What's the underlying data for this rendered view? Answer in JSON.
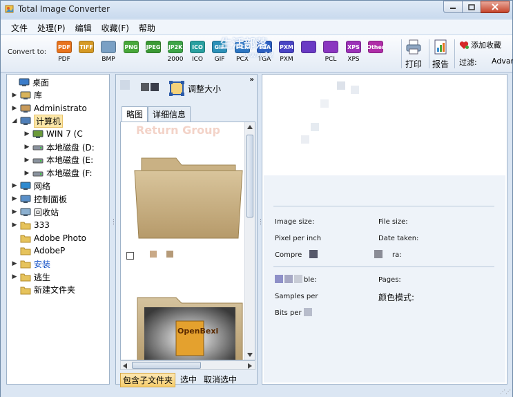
{
  "window": {
    "title": "Total Image Converter"
  },
  "menu": {
    "items": [
      "文件",
      "处理(P)",
      "编辑",
      "收藏(F)",
      "帮助"
    ]
  },
  "toolbar": {
    "convert_label": "Convert to:",
    "formats": [
      {
        "badge": "PDF",
        "label": "PDF",
        "color": "#e8731d"
      },
      {
        "badge": "TIFF",
        "label": "",
        "color": "#d69a25"
      },
      {
        "badge": "",
        "label": "BMP",
        "color": "#7aa0c4"
      },
      {
        "badge": "PNG",
        "label": "",
        "color": "#49a83a"
      },
      {
        "badge": "JPEG",
        "label": "",
        "color": "#3c9a35"
      },
      {
        "badge": "JP2K",
        "label": "2000",
        "color": "#3ea548"
      },
      {
        "badge": "ICO",
        "label": "ICO",
        "color": "#2aa0a0"
      },
      {
        "badge": "GIF",
        "label": "GIF",
        "color": "#2c91b8"
      },
      {
        "badge": "PCX",
        "label": "PCX",
        "color": "#2c76c2"
      },
      {
        "badge": "TGA",
        "label": "TGA",
        "color": "#2c5fc2"
      },
      {
        "badge": "PXM",
        "label": "PXM",
        "color": "#4a44c4"
      },
      {
        "badge": "",
        "label": "",
        "color": "#6a3ac4"
      },
      {
        "badge": "",
        "label": "PCL",
        "color": "#8a36c0"
      },
      {
        "badge": "XPS",
        "label": "XPS",
        "color": "#9c32b8"
      },
      {
        "badge": "Other",
        "label": "",
        "color": "#b02ea8"
      }
    ],
    "print_label": "打印",
    "report_label": "报告",
    "add_favorite": "添加收藏",
    "filter_label": "过滤:",
    "filter_value": "Advan"
  },
  "watermark": {
    "title": "生活部落  ",
    "url": "www.12"
  },
  "tree": {
    "items": [
      {
        "label": "桌面",
        "level": 0,
        "twisty": "",
        "icon": "desktop-icon"
      },
      {
        "label": "库",
        "level": 1,
        "twisty": "▶",
        "icon": "library-icon"
      },
      {
        "label": "Administrato",
        "level": 1,
        "twisty": "▶",
        "icon": "user-icon"
      },
      {
        "label": "计算机",
        "level": 1,
        "twisty": "◢",
        "icon": "computer-icon",
        "selected": true
      },
      {
        "label": "WIN 7 (C",
        "level": 2,
        "twisty": "▶",
        "icon": "windows-drive-icon"
      },
      {
        "label": "本地磁盘 (D:",
        "level": 2,
        "twisty": "▶",
        "icon": "drive-icon"
      },
      {
        "label": "本地磁盘 (E:",
        "level": 2,
        "twisty": "▶",
        "icon": "drive-icon"
      },
      {
        "label": "本地磁盘 (F:",
        "level": 2,
        "twisty": "▶",
        "icon": "drive-icon"
      },
      {
        "label": "网络",
        "level": 1,
        "twisty": "▶",
        "icon": "network-icon"
      },
      {
        "label": "控制面板",
        "level": 1,
        "twisty": "▶",
        "icon": "control-panel-icon"
      },
      {
        "label": "回收站",
        "level": 1,
        "twisty": "▶",
        "icon": "recycle-bin-icon"
      },
      {
        "label": "333",
        "level": 1,
        "twisty": "▶",
        "icon": "folder-icon"
      },
      {
        "label": "Adobe Photo",
        "level": 1,
        "twisty": "",
        "icon": "folder-icon"
      },
      {
        "label": "AdobeP",
        "level": 1,
        "twisty": "",
        "icon": "folder-icon"
      },
      {
        "label": "安装",
        "level": 1,
        "twisty": "▶",
        "icon": "folder-icon",
        "blue": true
      },
      {
        "label": "逃生",
        "level": 1,
        "twisty": "▶",
        "icon": "folder-icon"
      },
      {
        "label": "新建文件夹",
        "level": 1,
        "twisty": "",
        "icon": "folder-icon"
      }
    ]
  },
  "middle": {
    "resize_label": "调整大小",
    "more": "»",
    "tabs": [
      "略图",
      "详细信息"
    ],
    "faded_title": "Return Group",
    "thumb_label": "OpenBexi",
    "include_subfolders": "包含子文件夹",
    "select": "选中",
    "deselect": "取消选中"
  },
  "properties": {
    "image_size": "Image size:",
    "file_size": "File size:",
    "ppi": "Pixel per inch",
    "date_taken": "Date taken:",
    "compression": "Compre",
    "camera": "ra:",
    "table": "ble:",
    "pages": "Pages:",
    "samples": "Samples per",
    "color_mode": "颜色模式:",
    "bits": "Bits per"
  },
  "colors": {
    "selection": "#fbe6a7",
    "window_bg": "#dbe6f3",
    "accent_border": "#9fb3c9"
  }
}
